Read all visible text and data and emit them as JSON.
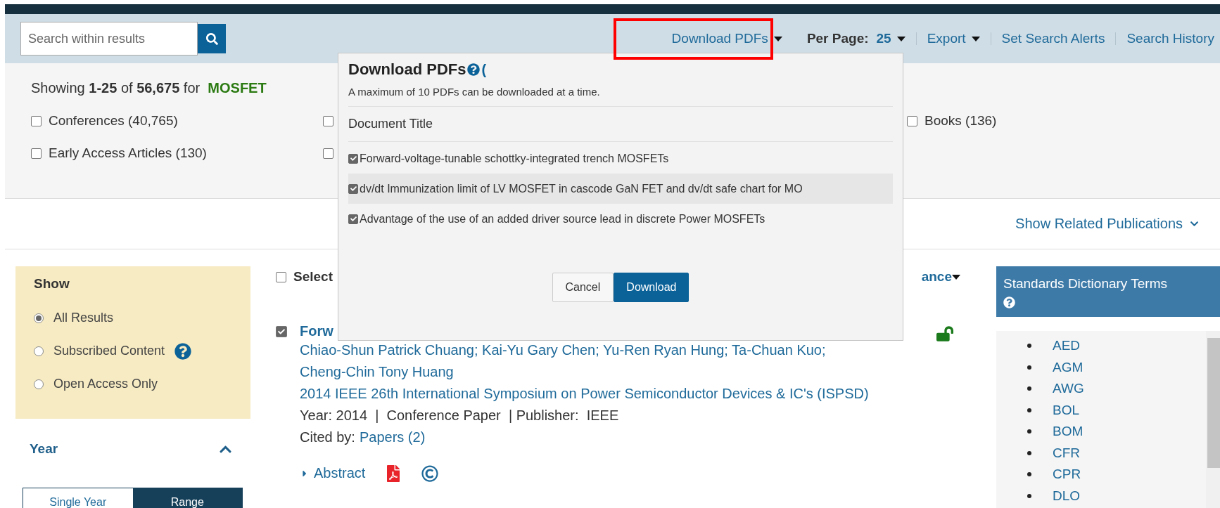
{
  "toolbar": {
    "search": {
      "placeholder": "Search within results"
    },
    "download_pdfs": {
      "label": "Download PDFs",
      "expanded": true
    },
    "per_page": {
      "label": "Per Page:",
      "value": "25"
    },
    "export": {
      "label": "Export"
    },
    "links": [
      "Set Search Alerts",
      "Search History"
    ]
  },
  "summary": {
    "prefix": "Showing",
    "range": "1-25",
    "of": "of",
    "total": "56,675",
    "for": "for",
    "query": "MOSFET"
  },
  "facets": [
    {
      "label": "Conferences (40,765)",
      "checked": false
    },
    {
      "checked": false
    },
    {
      "label": "Books (136)",
      "checked": false
    },
    {
      "label": "Early Access Articles (130)",
      "checked": false
    },
    {
      "checked": false
    }
  ],
  "related_link": "Show Related Publications",
  "sidebar": {
    "show": {
      "title": "Show",
      "options": [
        {
          "label": "All Results",
          "selected": true
        },
        {
          "label": "Subscribed Content",
          "selected": false,
          "help": true
        },
        {
          "label": "Open Access Only",
          "selected": false
        }
      ]
    },
    "year": {
      "title": "Year",
      "expanded": true,
      "modes": [
        {
          "label": "Single Year",
          "selected": false
        },
        {
          "label": "Range",
          "selected": true
        }
      ]
    }
  },
  "results_header": {
    "select_label": "Select",
    "select_checked": false,
    "sort_label": "ance"
  },
  "result": {
    "checked": true,
    "title": "Forw",
    "authors": [
      "Chiao-Shun Patrick Chuang",
      "Kai-Yu Gary Chen",
      "Yu-Ren Ryan Hung",
      "Ta-Chuan Kuo",
      "Cheng-Chin Tony Huang"
    ],
    "author_separator": ";",
    "venue": "2014 IEEE 26th International Symposium on Power Semiconductor Devices & IC's (ISPSD)",
    "meta": "Year: 2014  |  Conference Paper  | Publisher:  IEEE",
    "cited_label": "Cited by:",
    "cited_link": "Papers (2)",
    "abstract": "Abstract",
    "open_access": true
  },
  "terms_panel": {
    "title": "Standards Dictionary Terms",
    "terms": [
      "AED",
      "AGM",
      "AWG",
      "BOL",
      "BOM",
      "CFR",
      "CPR",
      "DLO"
    ]
  },
  "dialog": {
    "title": "Download PDFs",
    "title_tail": "(",
    "note": "A maximum of 10 PDFs can be downloaded at a time.",
    "column": "Document Title",
    "documents": [
      {
        "title": "Forward-voltage-tunable schottky-integrated trench MOSFETs",
        "checked": true,
        "highlighted": false
      },
      {
        "title": "dv/dt Immunization limit of LV MOSFET in cascode GaN FET and dv/dt safe chart for MO",
        "checked": true,
        "highlighted": true
      },
      {
        "title": "Advantage of the use of an added driver source lead in discrete Power MOSFETs",
        "checked": true,
        "highlighted": false
      }
    ],
    "buttons": [
      {
        "label": "Cancel",
        "kind": "secondary"
      },
      {
        "label": "Download",
        "kind": "primary"
      }
    ]
  }
}
